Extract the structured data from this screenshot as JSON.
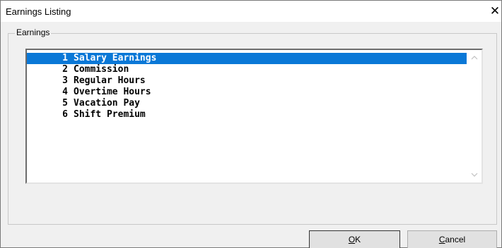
{
  "window": {
    "title": "Earnings Listing",
    "close_glyph": "✕"
  },
  "group": {
    "label": "Earnings"
  },
  "list": {
    "selected_index": 0,
    "items": [
      {
        "num": "1",
        "label": "Salary Earnings"
      },
      {
        "num": "2",
        "label": "Commission"
      },
      {
        "num": "3",
        "label": "Regular Hours"
      },
      {
        "num": "4",
        "label": "Overtime Hours"
      },
      {
        "num": "5",
        "label": "Vacation Pay"
      },
      {
        "num": "6",
        "label": "Shift Premium"
      }
    ]
  },
  "buttons": {
    "ok": {
      "mnemonic": "O",
      "rest": "K"
    },
    "cancel": {
      "mnemonic": "C",
      "rest": "ancel"
    }
  },
  "colors": {
    "selection": "#0a78d7",
    "dialog_bg": "#f0f0f0"
  }
}
